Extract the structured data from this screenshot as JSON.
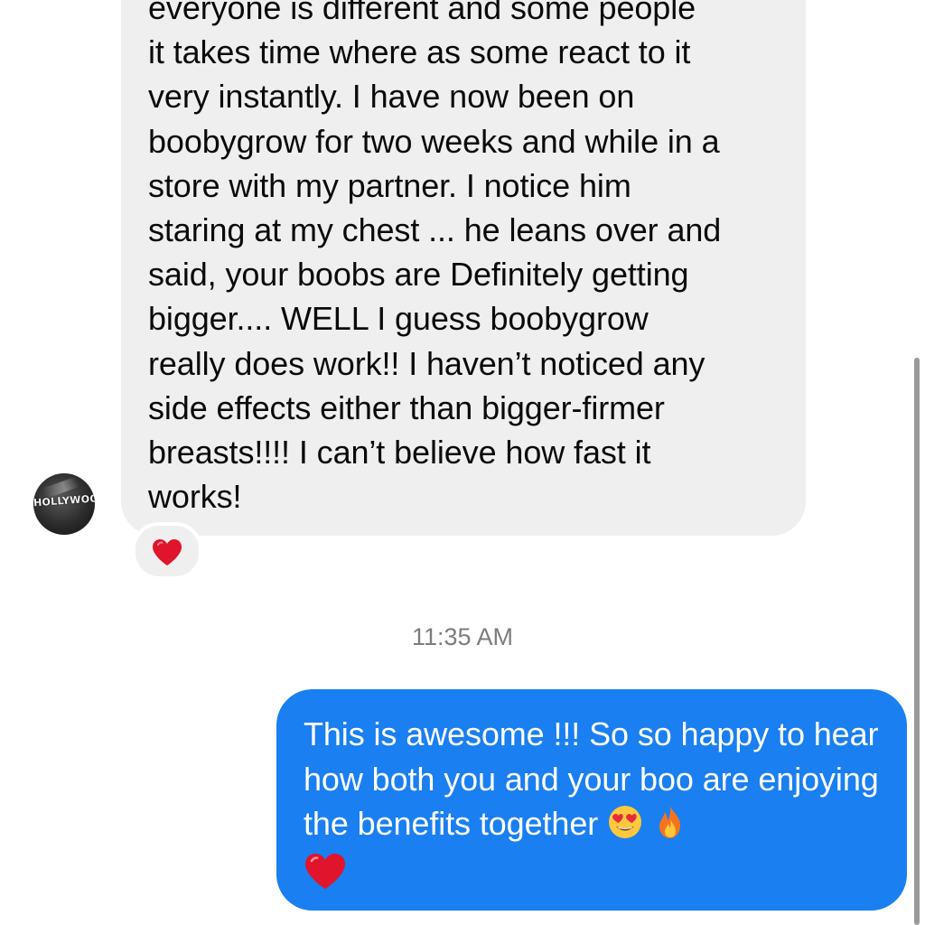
{
  "thread": {
    "incoming_message": {
      "text": "everyone is different and some people\nit takes time where as some react to it\nvery instantly. I have now been on\nboobygrow for two weeks and while in a\nstore with my partner. I notice him\nstaring at my chest ... he leans over and\nsaid, your boobs are Definitely getting\nbigger.... WELL I guess boobygrow\nreally does work!! I haven’t noticed any\nside effects either than bigger-firmer\nbreasts!!!! I can’t believe how fast it\nworks!",
      "reaction_icon": "red-heart-icon",
      "avatar_label": "HOLLYWOOD"
    },
    "timestamp": "11:35 AM",
    "outgoing_message": {
      "text": "This is awesome !!!  So so happy to hear how both you and your boo are enjoying the benefits together",
      "emojis": [
        "heart-eyes-emoji",
        "fire-emoji",
        "red-heart-emoji"
      ]
    }
  },
  "colors": {
    "incoming_bubble": "#efefef",
    "outgoing_bubble": "#1a7ff0",
    "heart": "#e0142a",
    "timestamp": "#7d7d7d"
  }
}
